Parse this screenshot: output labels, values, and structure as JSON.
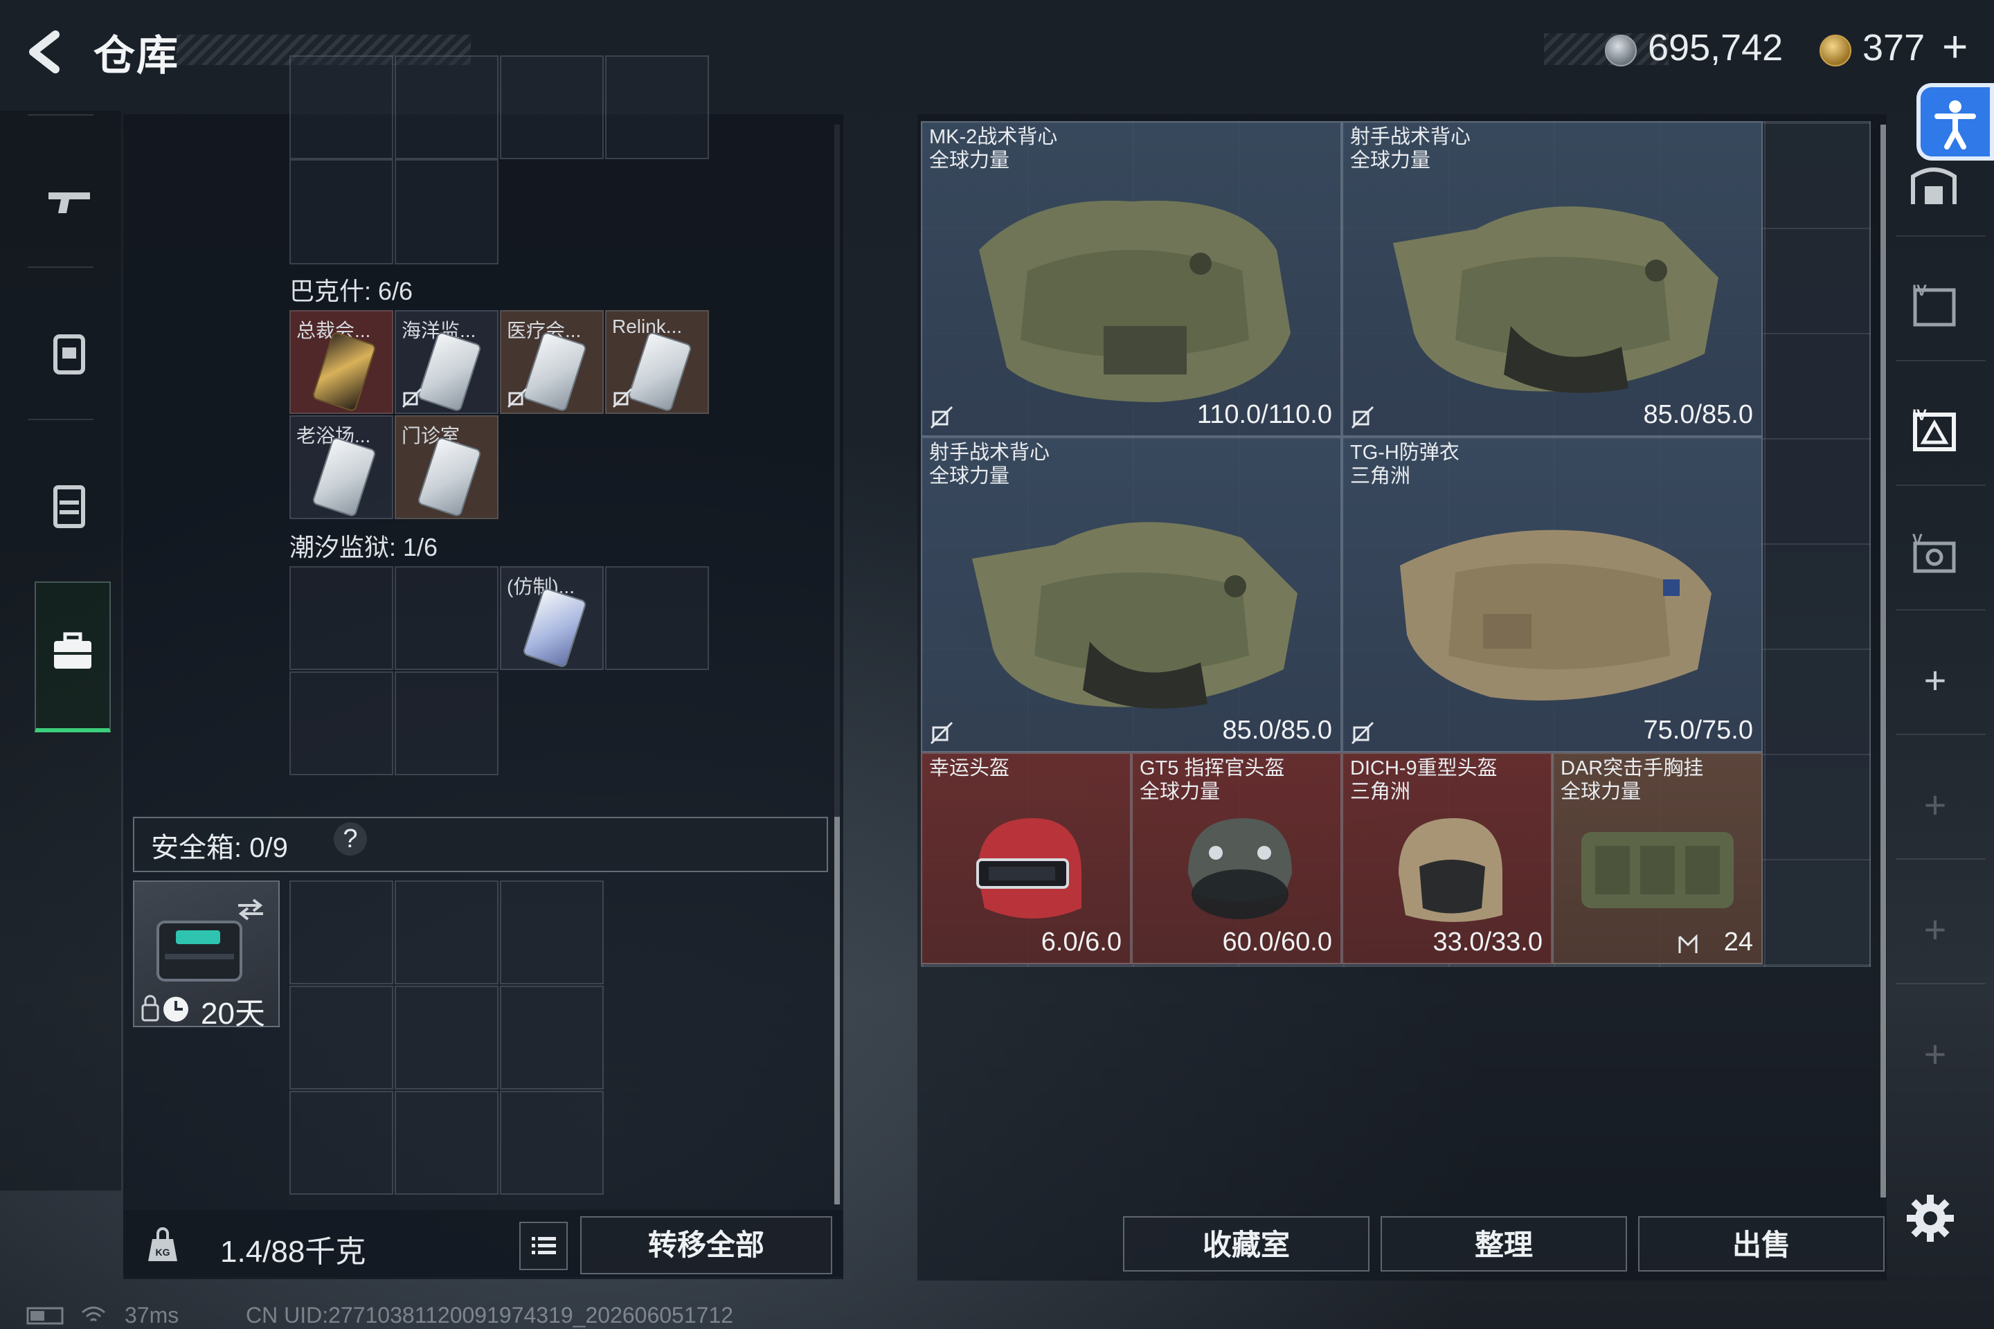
{
  "header": {
    "title": "仓库",
    "currency_silver": "695,742",
    "currency_gold": "377",
    "add_currency": "+"
  },
  "left_panel": {
    "sections": [
      {
        "label": "巴克什: 6/6"
      },
      {
        "label": "潮汐监狱: 1/6"
      }
    ],
    "bakshi_items": [
      {
        "label": "总裁会..."
      },
      {
        "label": "海洋监..."
      },
      {
        "label": "医疗会..."
      },
      {
        "label": "Relink..."
      },
      {
        "label": "老浴场..."
      },
      {
        "label": "门诊室"
      }
    ],
    "tide_items": [
      {
        "label": "(仿制)..."
      }
    ],
    "safebox": {
      "label": "安全箱: 0/9",
      "help": "?",
      "days": "20天"
    },
    "weight": "1.4/88千克",
    "transfer_all": "转移全部"
  },
  "stash": {
    "items": [
      {
        "name": "MK-2战术背心",
        "sub": "全球力量",
        "durability": "110.0/110.0"
      },
      {
        "name": "射手战术背心",
        "sub": "全球力量",
        "durability": "85.0/85.0"
      },
      {
        "name": "射手战术背心",
        "sub": "全球力量",
        "durability": "85.0/85.0"
      },
      {
        "name": "TG-H防弹衣",
        "sub": "三角洲",
        "durability": "75.0/75.0"
      },
      {
        "name": "幸运头盔",
        "sub": "",
        "durability": "6.0/6.0"
      },
      {
        "name": "GT5 指挥官头盔",
        "sub": "全球力量",
        "durability": "60.0/60.0"
      },
      {
        "name": "DICH-9重型头盔",
        "sub": "三角洲",
        "durability": "33.0/33.0"
      },
      {
        "name": "DAR突击手胸挂",
        "sub": "全球力量",
        "durability": "24"
      }
    ]
  },
  "bottom_buttons": {
    "collection": "收藏室",
    "organize": "整理",
    "sell": "出售"
  },
  "right_sidebar": {
    "plus": "+"
  },
  "status_bar": {
    "ping": "37ms",
    "uid": "CN UID:27710381120091974319_202606051712"
  },
  "colors": {
    "accent_green": "#3bd07a",
    "accessibility_blue": "#2f79e8"
  }
}
